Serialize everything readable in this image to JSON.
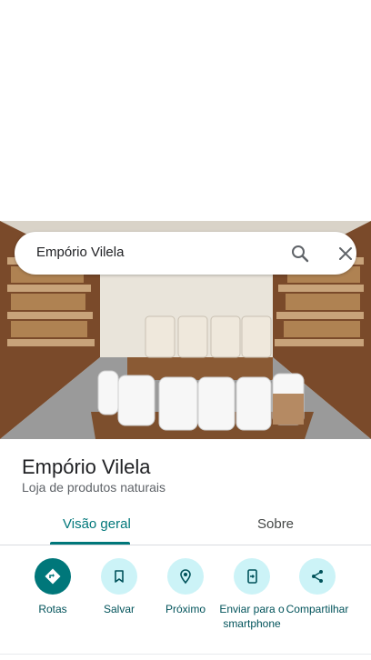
{
  "search": {
    "query": "Empório Vilela"
  },
  "place": {
    "name": "Empório Vilela",
    "category": "Loja de produtos naturais"
  },
  "tabs": [
    {
      "label": "Visão geral",
      "active": true
    },
    {
      "label": "Sobre",
      "active": false
    }
  ],
  "actions": [
    {
      "label": "Rotas",
      "icon": "directions-icon",
      "primary": true
    },
    {
      "label": "Salvar",
      "icon": "bookmark-icon",
      "primary": false
    },
    {
      "label": "Próximo",
      "icon": "nearby-icon",
      "primary": false
    },
    {
      "label": "Enviar para o smartphone",
      "icon": "send-to-phone-icon",
      "primary": false
    },
    {
      "label": "Compartilhar",
      "icon": "share-icon",
      "primary": false
    }
  ],
  "colors": {
    "accent": "#00777a",
    "action_bg": "#ccf3f7",
    "action_text": "#00525a"
  }
}
